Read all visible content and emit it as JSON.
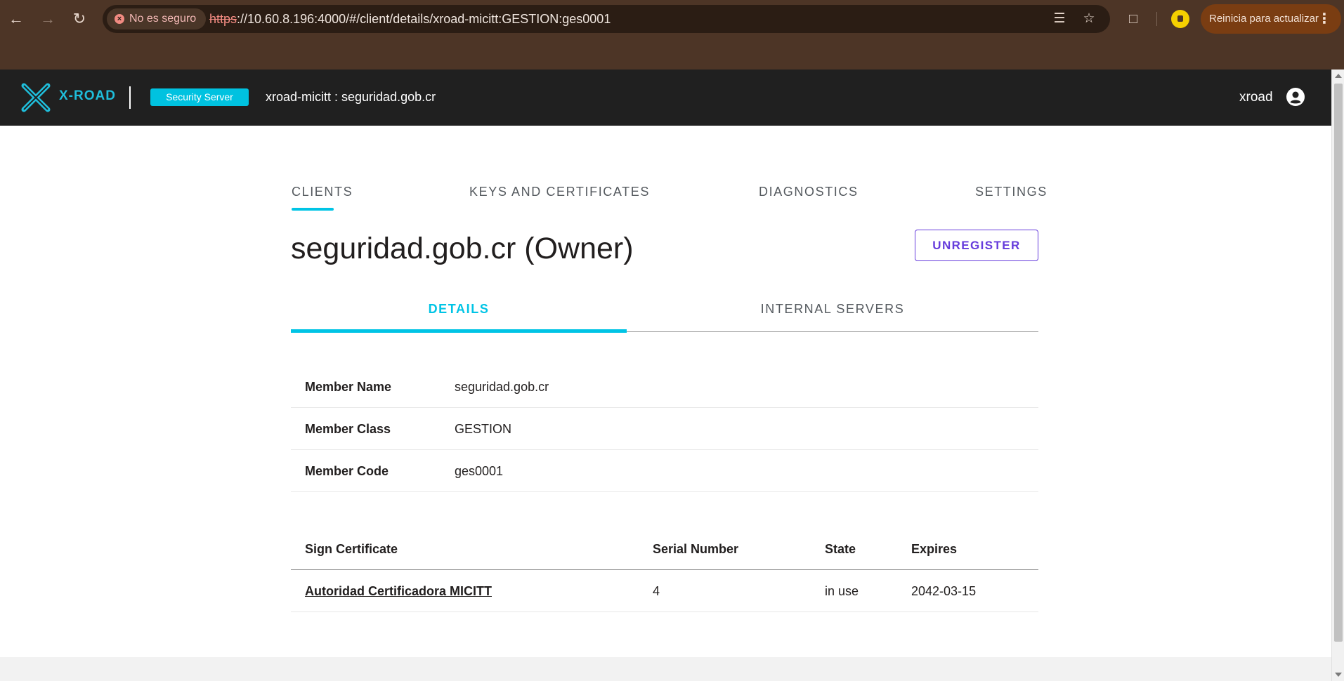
{
  "browser": {
    "security_label": "No es seguro",
    "url_scheme": "https",
    "url_rest": "://10.60.8.196:4000/#/client/details/xroad-micitt:GESTION:ges0001",
    "update_label": "Reinicia para actualizar",
    "icons": [
      "back-icon",
      "forward-icon",
      "reload-icon",
      "translate-icon",
      "star-icon",
      "extensions-icon",
      "profile-icon",
      "kebab-icon"
    ]
  },
  "header": {
    "logo_text": "X-ROAD",
    "badge": "Security Server",
    "server_id": "xroad-micitt : seguridad.gob.cr",
    "user": "xroad",
    "accent_color": "#00C4E5"
  },
  "main_tabs": [
    {
      "label": "CLIENTS",
      "active": true
    },
    {
      "label": "KEYS AND CERTIFICATES",
      "active": false
    },
    {
      "label": "DIAGNOSTICS",
      "active": false
    },
    {
      "label": "SETTINGS",
      "active": false
    }
  ],
  "client": {
    "title": "seguridad.gob.cr (Owner)",
    "unregister_label": "UNREGISTER"
  },
  "sub_tabs": [
    {
      "label": "DETAILS",
      "active": true
    },
    {
      "label": "INTERNAL SERVERS",
      "active": false
    }
  ],
  "details": [
    {
      "label": "Member Name",
      "value": "seguridad.gob.cr"
    },
    {
      "label": "Member Class",
      "value": "GESTION"
    },
    {
      "label": "Member Code",
      "value": "ges0001"
    }
  ],
  "certificates": {
    "headers": [
      "Sign Certificate",
      "Serial Number",
      "State",
      "Expires"
    ],
    "rows": [
      {
        "name": "Autoridad Certificadora MICITT",
        "serial": "4",
        "state": "in use",
        "expires": "2042-03-15"
      }
    ]
  }
}
